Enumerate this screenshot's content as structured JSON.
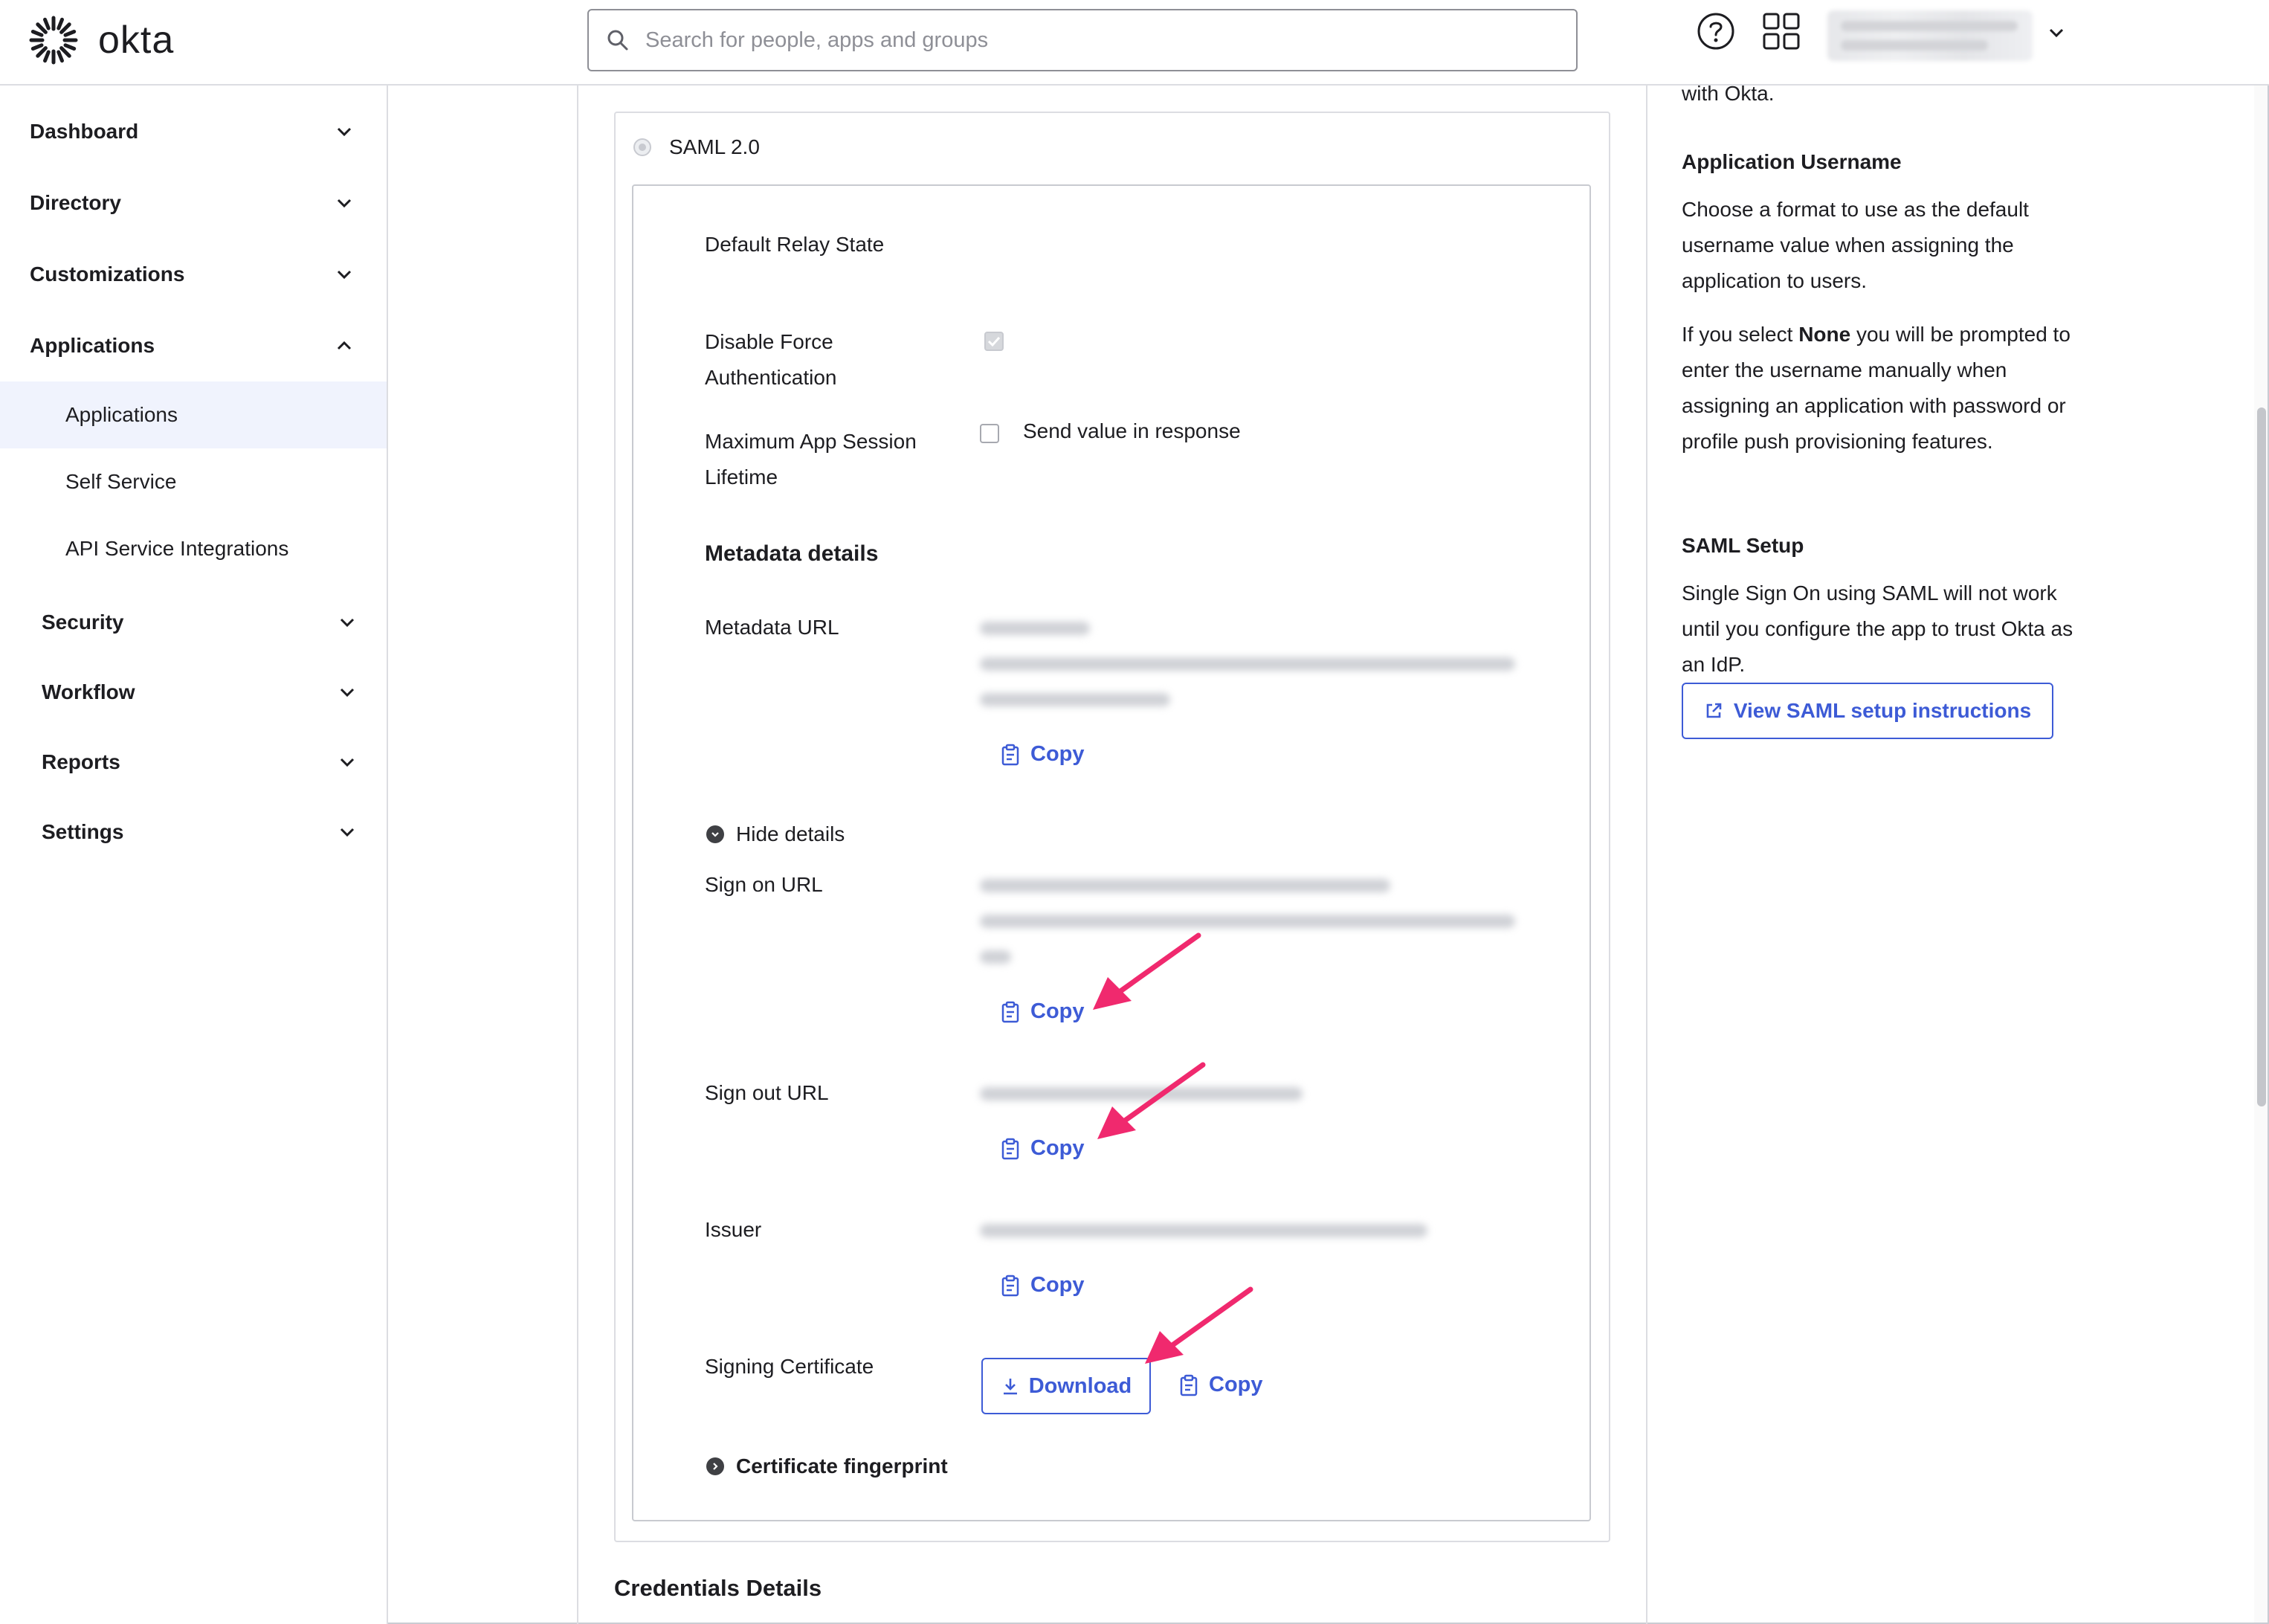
{
  "header": {
    "logo_text": "okta",
    "search_placeholder": "Search for people, apps and groups"
  },
  "sidebar": {
    "items": [
      {
        "label": "Dashboard",
        "expanded": false
      },
      {
        "label": "Directory",
        "expanded": false
      },
      {
        "label": "Customizations",
        "expanded": false
      },
      {
        "label": "Applications",
        "expanded": true
      },
      {
        "label": "Security",
        "expanded": false
      },
      {
        "label": "Workflow",
        "expanded": false
      },
      {
        "label": "Reports",
        "expanded": false
      },
      {
        "label": "Settings",
        "expanded": false
      }
    ],
    "sub_items": [
      {
        "label": "Applications",
        "active": true
      },
      {
        "label": "Self Service",
        "active": false
      },
      {
        "label": "API Service Integrations",
        "active": false
      }
    ]
  },
  "main": {
    "saml_label": "SAML 2.0",
    "default_relay_state": "Default Relay State",
    "disable_force_auth_line1": "Disable Force",
    "disable_force_auth_line2": "Authentication",
    "max_session_line1": "Maximum App Session",
    "max_session_line2": "Lifetime",
    "send_value_label": "Send value in response",
    "metadata_title": "Metadata details",
    "metadata_url_label": "Metadata URL",
    "copy_label": "Copy",
    "hide_details_label": "Hide details",
    "sign_on_url_label": "Sign on URL",
    "sign_out_url_label": "Sign out URL",
    "issuer_label": "Issuer",
    "signing_cert_label": "Signing Certificate",
    "download_label": "Download",
    "cert_fingerprint_label": "Certificate fingerprint",
    "credentials_title": "Credentials Details"
  },
  "right": {
    "top_text": "with Okta.",
    "app_username_title": "Application Username",
    "app_username_text": "Choose a format to use as the default username value when assigning the application to users.",
    "none_prefix": "If you select ",
    "none_bold": "None",
    "none_suffix": " you will be prompted to enter the username manually when assigning an application with password or profile push provisioning features.",
    "saml_setup_title": "SAML Setup",
    "saml_setup_text": "Single Sign On using SAML will not work until you configure the app to trust Okta as an IdP.",
    "saml_setup_button": "View SAML setup instructions"
  },
  "colors": {
    "accent": "#3d5bd6",
    "arrow": "#f0296e",
    "active_bg": "#f0f3fd"
  }
}
